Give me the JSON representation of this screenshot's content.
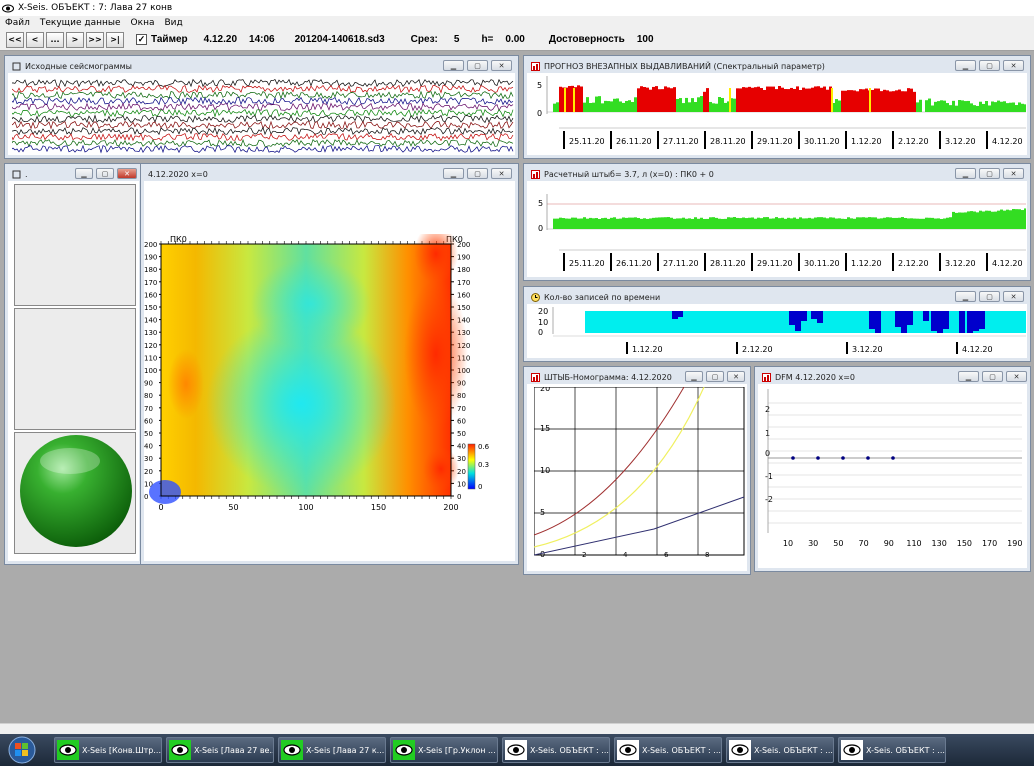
{
  "app": {
    "title": "X-Seis.  ОБЪЕКТ : 7: Лава 27 конв"
  },
  "menu": [
    "Файл",
    "Текущие данные",
    "Окна",
    "Вид"
  ],
  "toolbar": {
    "nav_buttons": [
      "<<",
      "<",
      "...",
      ">",
      ">>",
      ">|"
    ],
    "timer_checked": "✓",
    "timer_label": "Таймер",
    "date": "4.12.20",
    "time": "14:06",
    "file": "201204-140618.sd3",
    "slice_label": "Срез:",
    "slice_value": "5",
    "h_label": "h=",
    "h_value": "0.00",
    "reliability_label": "Достоверность",
    "reliability_value": "100"
  },
  "windows": {
    "seismograms": {
      "title": "Исходные сейсмограммы"
    },
    "forecast": {
      "title": "ПРОГНОЗ ВНЕЗАПНЫХ ВЫДАВЛИВАНИЙ (Спектральный параметр)",
      "y_ticks": [
        "5",
        "0"
      ],
      "dates": [
        "25.11.20",
        "26.11.20",
        "27.11.20",
        "28.11.20",
        "29.11.20",
        "30.11.20",
        "1.12.20",
        "2.12.20",
        "3.12.20",
        "4.12.20"
      ]
    },
    "calc": {
      "title": "Расчетный штыб= 3.7, л  (x=0) : ПК0 + 0",
      "y_ticks": [
        "5",
        "0"
      ],
      "dates": [
        "25.11.20",
        "26.11.20",
        "27.11.20",
        "28.11.20",
        "29.11.20",
        "30.11.20",
        "1.12.20",
        "2.12.20",
        "3.12.20",
        "4.12.20"
      ]
    },
    "records": {
      "title": "Кол-во записей по времени",
      "y_ticks": [
        "20",
        "10",
        "0"
      ],
      "dates": [
        "1.12.20",
        "2.12.20",
        "3.12.20",
        "4.12.20"
      ]
    },
    "nomogram": {
      "title": "ШТЫБ-Номограмма:  4.12.2020",
      "y_ticks": [
        "20",
        "15",
        "10",
        "5",
        "0"
      ],
      "x_ticks": [
        "2",
        "4",
        "6",
        "8"
      ]
    },
    "dfm": {
      "title": "DFM  4.12.2020  x=0",
      "y_ticks": [
        "2",
        "1",
        "0",
        "-1",
        "-2"
      ],
      "x_ticks": [
        "10",
        "30",
        "50",
        "70",
        "90",
        "110",
        "130",
        "150",
        "170",
        "190"
      ]
    },
    "heatmap": {
      "title": "4.12.2020  x=0",
      "pk_left": "ПК0",
      "pk_right": "ПК0",
      "y_ticks": [
        "200",
        "190",
        "180",
        "170",
        "160",
        "150",
        "140",
        "130",
        "120",
        "110",
        "100",
        "90",
        "80",
        "70",
        "60",
        "50",
        "40",
        "30",
        "20",
        "10",
        "0"
      ],
      "x_ticks": [
        "0",
        "50",
        "100",
        "150",
        "200"
      ],
      "scale": [
        "0.6",
        "0.3",
        "0"
      ]
    },
    "panel": {
      "title": "."
    }
  },
  "taskbar": {
    "items": [
      {
        "label": "X-Seis [Конв.Штр..."
      },
      {
        "label": "X-Seis [Лава 27 ве..."
      },
      {
        "label": "X-Seis [Лава 27 к..."
      },
      {
        "label": "X-Seis [Гр.Уклон ..."
      },
      {
        "label": "X-Seis.  ОБЪЕКТ : ..."
      },
      {
        "label": "X-Seis.  ОБЪЕКТ : ..."
      },
      {
        "label": "X-Seis.  ОБЪЕКТ : ..."
      },
      {
        "label": "X-Seis.  ОБЪЕКТ : ..."
      }
    ]
  },
  "colors": {
    "red": "#e60000",
    "green": "#33dd22",
    "cyan": "#00eeee",
    "blue": "#0000cc",
    "desktop": "#ababab"
  }
}
